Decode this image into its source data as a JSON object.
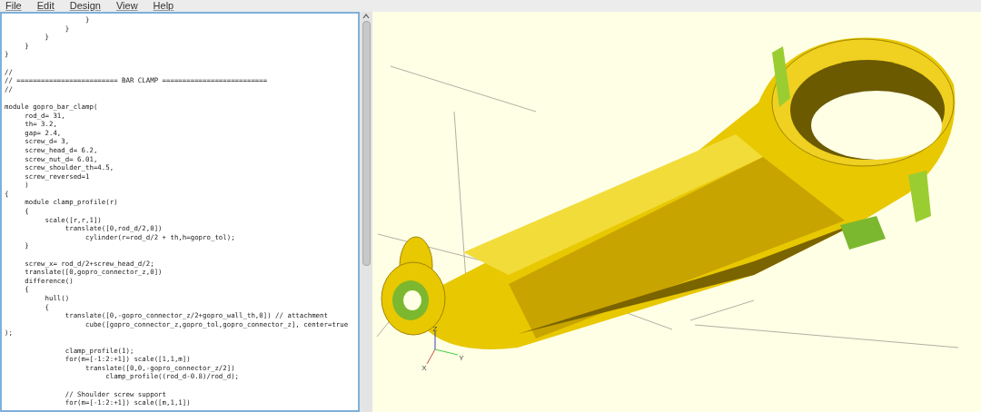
{
  "menu": [
    {
      "label": "File"
    },
    {
      "label": "Edit"
    },
    {
      "label": "Design"
    },
    {
      "label": "View"
    },
    {
      "label": "Help"
    }
  ],
  "editor": {
    "blocks": [
      [
        "                    }",
        "               }",
        "          }",
        "     }",
        "}"
      ],
      [
        "//",
        "// ========================= BAR CLAMP ==========================",
        "//"
      ],
      [
        "module gopro_bar_clamp(",
        "     rod_d= 31,",
        "     th= 3.2,",
        "     gap= 2.4,",
        "     screw_d= 3,",
        "     screw_head_d= 6.2,",
        "     screw_nut_d= 6.01,",
        "     screw_shoulder_th=4.5,",
        "     screw_reversed=1",
        "     )",
        "{",
        "     module clamp_profile(r)",
        "     {",
        "          scale([r,r,1])",
        "               translate([0,rod_d/2,0])",
        "                    cylinder(r=rod_d/2 + th,h=gopro_tol);",
        "     }"
      ],
      [
        "     screw_x= rod_d/2+screw_head_d/2;",
        "     translate([0,gopro_connector_z,0])",
        "     difference()",
        "     {",
        "          hull()",
        "          {",
        "               translate([0,-gopro_connector_z/2+gopro_wall_th,0]) // attachment",
        "                    cube([gopro_connector_z,gopro_tol,gopro_connector_z], center=true",
        ");"
      ],
      [
        "               clamp_profile(1);",
        "               for(m=[-1:2:+1]) scale([1,1,m])",
        "                    translate([0,0,-gopro_connector_z/2])",
        "                         clamp_profile((rod_d-0.8)/rod_d);"
      ],
      [
        "               // Shoulder screw support",
        "               for(m=[-1:2:+1]) scale([m,1,1])"
      ]
    ]
  },
  "viewport": {
    "axis_labels": [
      {
        "kind": "z",
        "label": "Z"
      },
      {
        "kind": "y",
        "label": "Y"
      },
      {
        "kind": "x",
        "label": "X"
      }
    ]
  }
}
